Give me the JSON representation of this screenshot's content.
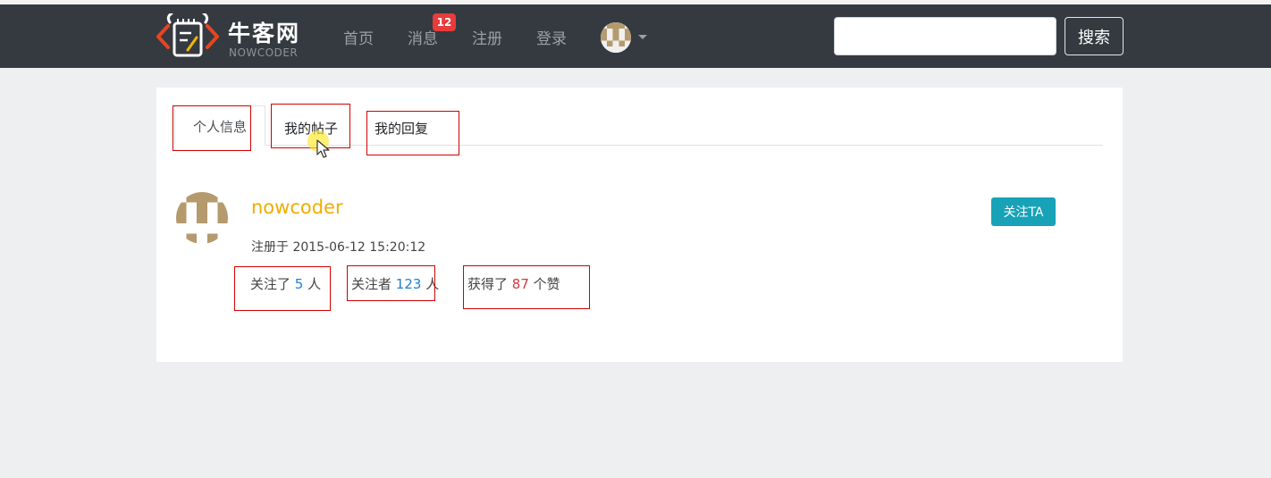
{
  "navbar": {
    "brand_cn": "牛客网",
    "brand_en": "NOWCODER",
    "links": {
      "home": "首页",
      "messages": "消息",
      "register": "注册",
      "login": "登录"
    },
    "message_badge": "12",
    "search": {
      "value": "",
      "placeholder": "",
      "button_label": "搜索"
    }
  },
  "tabs": {
    "profile": "个人信息",
    "posts": "我的帖子",
    "replies": "我的回复"
  },
  "profile": {
    "username": "nowcoder",
    "registered": "注册于 2015-06-12 15:20:12",
    "following": {
      "prefix": "关注了 ",
      "count": "5",
      "suffix": " 人"
    },
    "followers": {
      "prefix": "关注者 ",
      "count": "123",
      "suffix": " 人"
    },
    "likes": {
      "prefix": "获得了 ",
      "count": "87",
      "suffix": " 个赞"
    },
    "follow_button": "关注TA"
  },
  "colors": {
    "navbar_bg": "#343a40",
    "username": "#f0ad00",
    "count_blue": "#1e7fd6",
    "count_red": "#d9363e",
    "follow_button": "#17a2b8",
    "badge": "#e83b3b",
    "annotation_box": "#d10000"
  }
}
